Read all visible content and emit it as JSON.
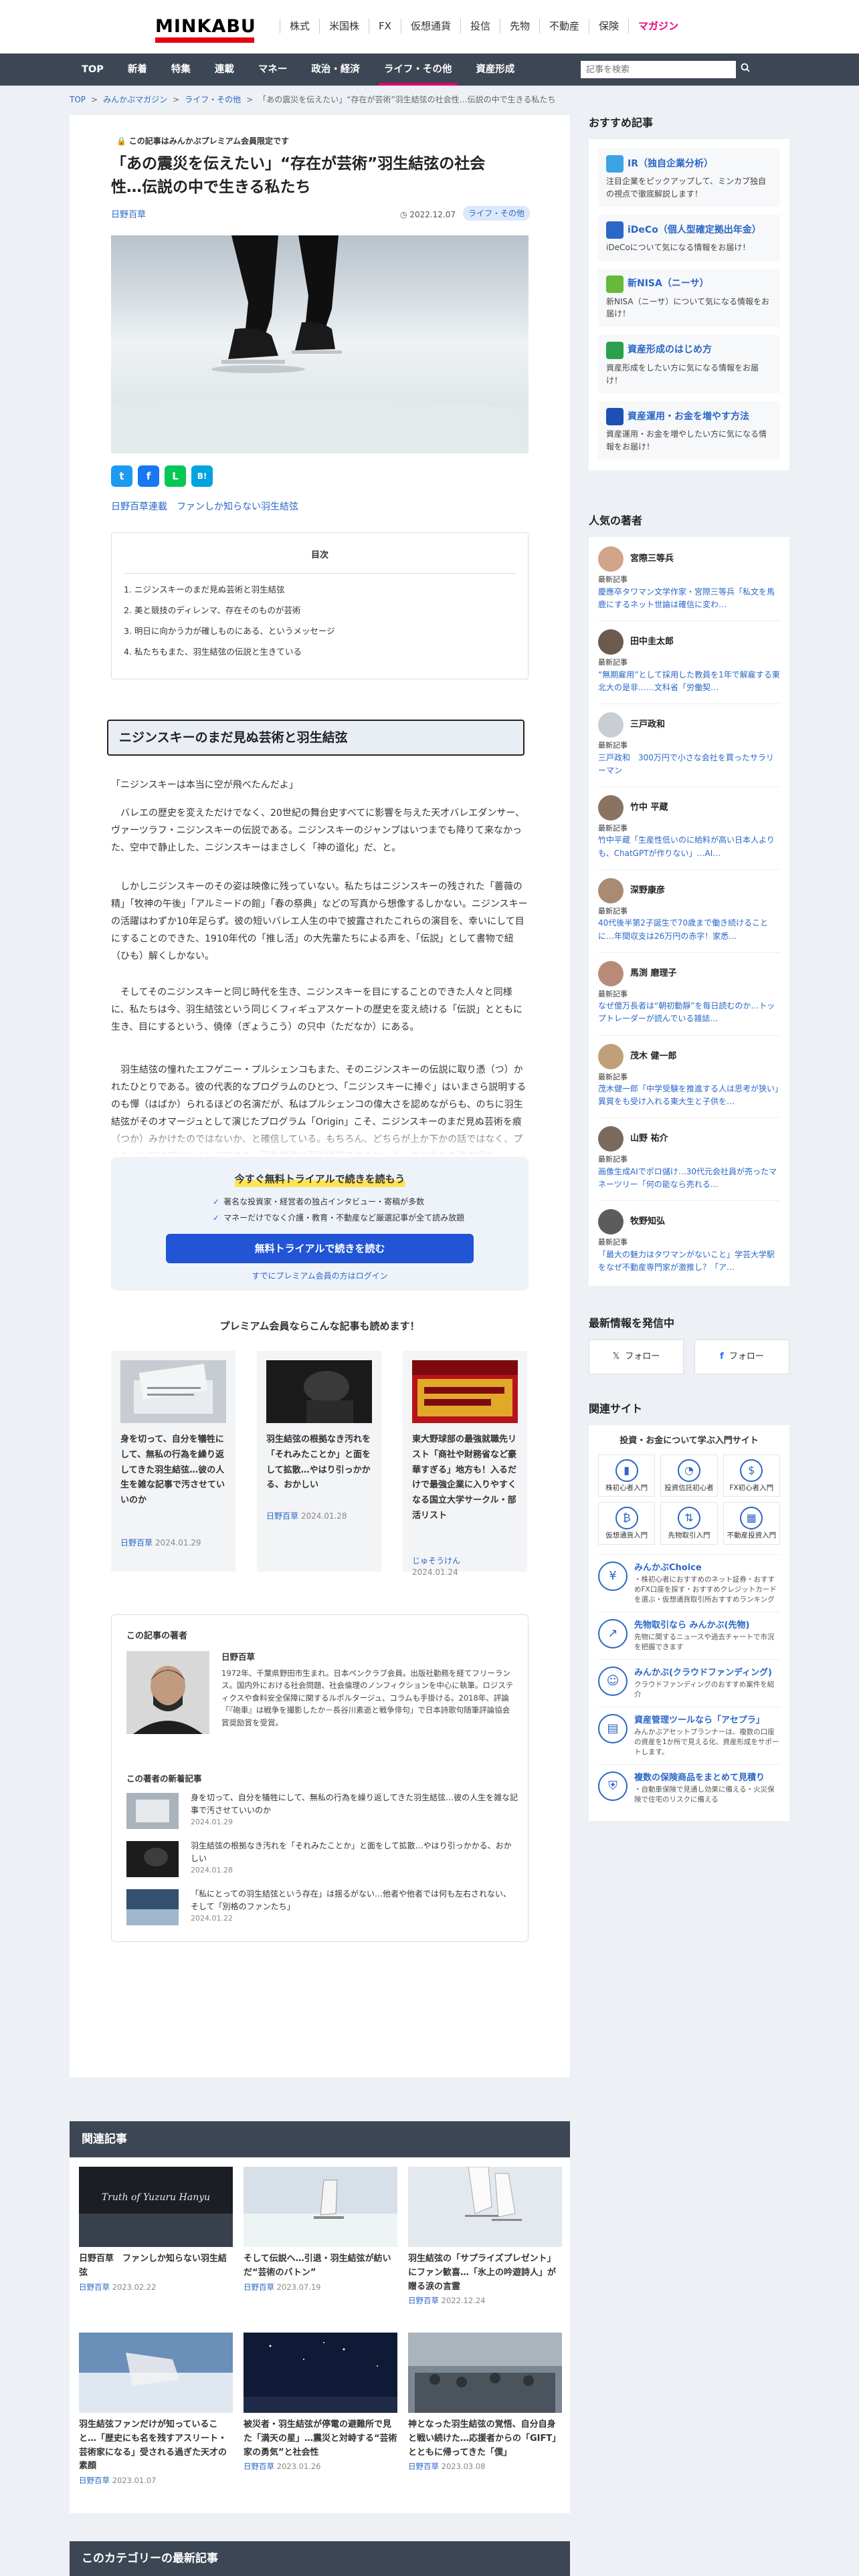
{
  "header": {
    "logo": "MINKABU",
    "top_nav": [
      "株式",
      "米国株",
      "FX",
      "仮想通貨",
      "投信",
      "先物",
      "不動産",
      "保険",
      "マガジン"
    ],
    "global_nav": [
      "TOP",
      "新着",
      "特集",
      "連載",
      "マネー",
      "政治・経済",
      "ライフ・その他",
      "資産形成"
    ],
    "search_placeholder": "記事を検索"
  },
  "breadcrumb": [
    "TOP",
    "みんかぶマガジン",
    "ライフ・その他",
    "「あの震災を伝えたい」“存在が芸術”羽生結弦の社会性…伝説の中で生きる私たち"
  ],
  "article": {
    "premium_note": "この記事はみんかぶプレミアム会員限定です",
    "title": "「あの震災を伝えたい」“存在が芸術”羽生結弦の社会性…伝説の中で生きる私たち",
    "author": "日野百草",
    "date": "2022.12.07",
    "category_tag": "ライフ・その他",
    "share": [
      "t",
      "f",
      "L",
      "B!"
    ],
    "series_link": "日野百草連載　ファンしか知らない羽生結弦",
    "toc_title": "目次",
    "toc": [
      "1. ニジンスキーのまだ見ぬ芸術と羽生結弦",
      "2. 美と競技のディレンマ、存在そのものが芸術",
      "3. 明日に向かう力が確しものにある、というメッセージ",
      "4. 私たちもまた、羽生結弦の伝説と生きている"
    ],
    "h2": "ニジンスキーのまだ見ぬ芸術と羽生結弦",
    "paragraphs": [
      "「ニジンスキーは本当に空が飛べたんだよ」",
      "　バレエの歴史を変えただけでなく、20世紀の舞台史すべてに影響を与えた天才バレエダンサー、ヴァーツラフ・ニジンスキーの伝説である。ニジンスキーのジャンプはいつまでも降りて来なかった、空中で静止した、ニジンスキーはまさしく「神の道化」だ、と。",
      "　しかしニジンスキーのその姿は映像に残っていない。私たちはニジンスキーの残された「薔薇の精」「牧神の午後」「アルミードの館」「春の祭典」などの写真から想像するしかない。ニジンスキーの活躍はわずか10年足らず。彼の短いバレエ人生の中で披露されたこれらの演目を、幸いにして目にすることのできた、1910年代の「推し活」の大先輩たちによる声を、「伝説」として書物で紐（ひも）解くしかない。",
      "　そしてそのニジンスキーと同じ時代を生き、ニジンスキーを目にすることのできた人々と同様に、私たちは今、羽生結弦という同じくフィギュアスケートの歴史を変え続ける「伝説」とともに生き、目にするという、僥倖（ぎょうこう）の只中（ただなか）にある。",
      "　羽生結弦の憧れたエフゲニー・プルシェンコもまた、そのニジンスキーの伝説に取り憑（つ）かれたひとりである。彼の代表的なプログラムのひとつ、「ニジンスキーに捧ぐ」はいまさら説明するのも憚（はばか）られるほどの名演だが、私はプルシェンコの偉大さを認めながらも、のちに羽生結弦がそのオマージュとして演じたプログラム「Origin」こそ、ニジンスキーのまだ見ぬ芸術を痕（つか）みかけたのではないか、と確信している。もちろん、どちらが上か下かの話ではなく、プルシェンコはプルシェンコであり、羽生結弦は羽生結弦であるという、それぞれの姿の話だ。"
    ],
    "paywall": {
      "heading": "今すぐ無料トライアルで続きを読もう",
      "benefits": [
        "著名な投資家・経営者の独占インタビュー・寄稿が多数",
        "マネーだけでなく介護・教育・不動産など厳選記事が全て読み放題"
      ],
      "cta": "無料トライアルで続きを読む",
      "login": "すでにプレミアム会員の方はログイン"
    },
    "premium_heading": "プレミアム会員ならこんな記事も読めます！",
    "premium_cards": [
      {
        "title": "身を切って、自分を犠牲にして、無私の行為を繰り返してきた羽生結弦…彼の人生を雑な記事で汚させていいのか",
        "author": "日野百草",
        "date": "2024.01.29"
      },
      {
        "title": "羽生結弦の根拠なき汚れを「それみたことか」と面をして拡散…やはり引っかかる、おかしい",
        "author": "日野百草",
        "date": "2024.01.28"
      },
      {
        "title": "東大野球部の最強就職先リスト「商社や財務省など豪華すぎる」地方も！入るだけで最強企業に入りやすくなる国立大学サークル・部活リスト",
        "author": "じゅそうけん",
        "date": "2024.01.24"
      }
    ],
    "author_box": {
      "heading": "この記事の著者",
      "name": "日野百草",
      "bio": "1972年、千葉県野田市生まれ。日本ペンクラブ会員。出版社勤務を経てフリーランス。国内外における社会問題、社会倫理のノンフィクションを中心に執筆。ロジスティクスや食料安全保障に関するルポルタージュ、コラムも手掛ける。2018年、評論「『砲車』は戦争を撮影したか－長谷川素逝と戦争俳句」で日本詩歌句随筆評論協会賞奨励賞を受賞。",
      "latest_heading": "この著者の新着記事",
      "latest": [
        {
          "title": "身を切って、自分を犠牲にして、無私の行為を繰り返してきた羽生結弦…彼の人生を雑な記事で汚させていいのか",
          "date": "2024.01.29"
        },
        {
          "title": "羽生結弦の根拠なき汚れを「それみたことか」と面をして拡散…やはり引っかかる、おかしい",
          "date": "2024.01.28"
        },
        {
          "title": "「私にとっての羽生結弦という存在」は揺るがない…他者や他者では何も左右されない、そして「別格のファンたち」",
          "date": "2024.01.22"
        }
      ]
    }
  },
  "related": {
    "heading": "関連記事",
    "cards": [
      {
        "title": "日野百草　ファンしか知らない羽生結弦",
        "author": "日野百草",
        "date": "2023.02.22"
      },
      {
        "title": "そして伝説へ…引退・羽生結弦が紡いだ“芸術のバトン”",
        "author": "日野百草",
        "date": "2023.07.19"
      },
      {
        "title": "羽生結弦の「サプライズプレゼント」にファン歓喜…「氷上の吟遊詩人」が贈る涙の言霊",
        "author": "日野百草",
        "date": "2022.12.24"
      },
      {
        "title": "羽生結弦ファンだけが知っていること…「歴史にも名を残すアスリート・芸術家になる」受される過ぎた天才の素顔",
        "author": "日野百草",
        "date": "2023.01.07"
      },
      {
        "title": "被災者・羽生結弦が停電の避難所で見た「満天の星」…震災と対峙する“芸術家の勇気”と社会性",
        "author": "日野百草",
        "date": "2023.01.26"
      },
      {
        "title": "神となった羽生結弦の覚悟、自分自身と戦い続けた…応援者からの「GIFT」とともに帰ってきた「僕」",
        "author": "日野百草",
        "date": "2023.03.08"
      }
    ],
    "image_caption": "Truth of Yuzuru Hanyu"
  },
  "category_heading": "このカテゴリーの最新記事",
  "sidebar": {
    "recommend_heading": "おすすめ記事",
    "recommend": [
      {
        "title": "IR（独自企業分析）",
        "desc": "注目企業をピックアップして、ミンカブ独自の視点で徹底解説します！",
        "color": "#3aa4e5"
      },
      {
        "title": "iDeCo（個人型確定拠出年金）",
        "desc": "iDeCoについて気になる情報をお届け！",
        "color": "#2b67c6"
      },
      {
        "title": "新NISA（ニーサ）",
        "desc": "新NISA（ニーサ）について気になる情報をお届け！",
        "color": "#67b93b"
      },
      {
        "title": "資産形成のはじめ方",
        "desc": "資産形成をしたい方に気になる情報をお届け！",
        "color": "#2aa04f"
      },
      {
        "title": "資産運用・お金を増やす方法",
        "desc": "資産運用・お金を増やしたい方に気になる情報をお届け！",
        "color": "#1d4fb4"
      }
    ],
    "popular_heading": "人気の著者",
    "latest_label": "最新記事",
    "popular": [
      {
        "name": "宮際三等兵",
        "title": "慶應卒タワマン文学作家・宮際三等兵「私文を馬鹿にするネット世論は確信に変わ…"
      },
      {
        "name": "田中圭太郎",
        "title": "“無期雇用”として採用した教員を1年で解雇する東北大の是非……文科省「労働契…"
      },
      {
        "name": "三戸政和",
        "title": "三戸政和　300万円で小さな会社を買ったサラリーマン"
      },
      {
        "name": "竹中 平蔵",
        "title": "竹中平蔵「生産性低いのに給料が高い日本人よりも、ChatGPTが作りない」…AI…"
      },
      {
        "name": "深野康彦",
        "title": "40代後半第2子誕生で70歳まで働き続けることに…年間収支は26万円の赤字！家悉…"
      },
      {
        "name": "馬渕 磨理子",
        "title": "なぜ億万長者は“朝初動靜”を毎日読むのか…トップトレーダーが読んでいる雑誌…"
      },
      {
        "name": "茂木 健一郎",
        "title": "茂木健一郎「中学受験を推進する人は思考が狭い」異質をも受け入れる東大生と子供を…"
      },
      {
        "name": "山野 祐介",
        "title": "画像生成AIでポロ儲け…30代元会社員が売ったマネーツリー「何の能なら売れる…"
      },
      {
        "name": "牧野知弘",
        "title": "「最大の魅力はタワマンがないこと」学芸大学駅をなぜ不動産専門家が激推し？「ア…"
      }
    ],
    "social_heading": "最新情報を発信中",
    "follow": [
      "フォロー",
      "フォロー"
    ],
    "related_sites_heading": "関連サイト",
    "sites_box_heading": "投資・お金について学ぶ入門サイト",
    "sites": [
      "株初心者入門",
      "投資信託初心者",
      "FX初心者入門",
      "仮想通貨入門",
      "先物取引入門",
      "不動産投資入門"
    ],
    "services": [
      {
        "name": "みんかぶChoice",
        "desc": "・株初心者におすすめのネット証券・おすすめFX口座を探す・おすすめクレジットカードを選ぶ・仮想通貨取引所おすすめランキング"
      },
      {
        "name": "先物取引なら みんかぶ(先物)",
        "desc": "先物に関するニュースや過去チャートで市況を把握できます"
      },
      {
        "name": "みんかぶ(クラウドファンディング)",
        "desc": "クラウドファンディングのおすすめ案件を紹介"
      },
      {
        "name": "資産管理ツールなら「アセプラ」",
        "desc": "みんかぶアセットプランナーは、複数の口座の資産を1か所で見える化、資産形成をサポートします。"
      },
      {
        "name": "複数の保険商品をまとめて見積り",
        "desc": "・自動車保険で見通し効果に備える・火災保険で住宅のリスクに備える"
      }
    ]
  }
}
